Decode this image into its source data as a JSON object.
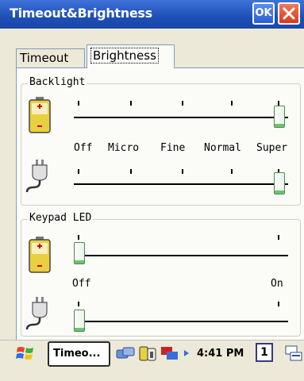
{
  "window": {
    "title": "Timeout&Brightness",
    "ok_label": "OK",
    "close_label": "×"
  },
  "tabs": [
    {
      "label": "Timeout",
      "selected": false
    },
    {
      "label": "Brightness",
      "selected": true
    }
  ],
  "backlight": {
    "label": "Backlight",
    "levels": [
      "Off",
      "Micro",
      "Fine",
      "Normal",
      "Super"
    ],
    "battery_value": "Super",
    "ac_value": "Super"
  },
  "keypad_led": {
    "label": "Keypad LED",
    "levels": [
      "Off",
      "On"
    ],
    "battery_value": "Off",
    "ac_value": "Off"
  },
  "taskbar": {
    "app_label": "Timeo...",
    "time": "4:41 PM",
    "desktop_number": "1"
  },
  "icons": {
    "start": "windows-flag-icon",
    "battery": "battery-icon",
    "plug": "power-plug-icon",
    "network": "network-icon",
    "sync": "sync-icon",
    "input": "input-panel-icon"
  }
}
